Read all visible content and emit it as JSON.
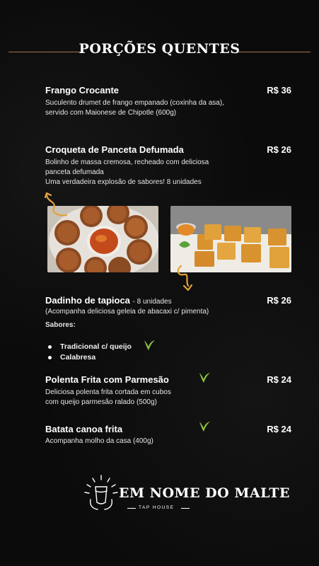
{
  "header": {
    "title": "PORÇÕES QUENTES"
  },
  "items": [
    {
      "name": "Frango Crocante",
      "price": "R$ 36",
      "description": [
        "Suculento drumet de frango empanado (coxinha da asa),",
        "servido com Maionese de Chipotle (600g)"
      ]
    },
    {
      "name": "Croqueta de Panceta Defumada",
      "price": "R$ 26",
      "description": [
        "Bolinho de massa cremosa, recheado com deliciosa",
        "panceta defumada",
        "Uma verdadeira explosão de sabores! 8 unidades"
      ]
    },
    {
      "name": "Dadinho de tapioca",
      "name_suffix": "- 8 unidades",
      "price": "R$ 26",
      "description": [
        "(Acompanha deliciosa geleia de abacaxi c/ pimenta)"
      ],
      "flavors_label": "Sabores:",
      "flavors": [
        "Tradicional c/ queijo",
        "Calabresa"
      ]
    },
    {
      "name": "Polenta Frita com Parmesão",
      "price": "R$ 24",
      "description": [
        "Deliciosa polenta frita cortada em cubos",
        "com queijo parmesão ralado (500g)"
      ]
    },
    {
      "name": "Batata canoa frita",
      "price": "R$ 24",
      "description": [
        "Acompanha molho da casa (400g)"
      ]
    }
  ],
  "icons": {
    "vegetarian": "vegetarian-leaf-icon",
    "arrow": "curly-arrow-icon",
    "logo": "beer-glass-sunburst-logo"
  },
  "logo": {
    "main": "EM NOME DO MALTE",
    "sub": "TAP HOUSE"
  },
  "colors": {
    "background": "#0b0b0b",
    "accent": "#e3a33a",
    "leaf": "#8cc63f",
    "divider": "#a07a4a"
  }
}
